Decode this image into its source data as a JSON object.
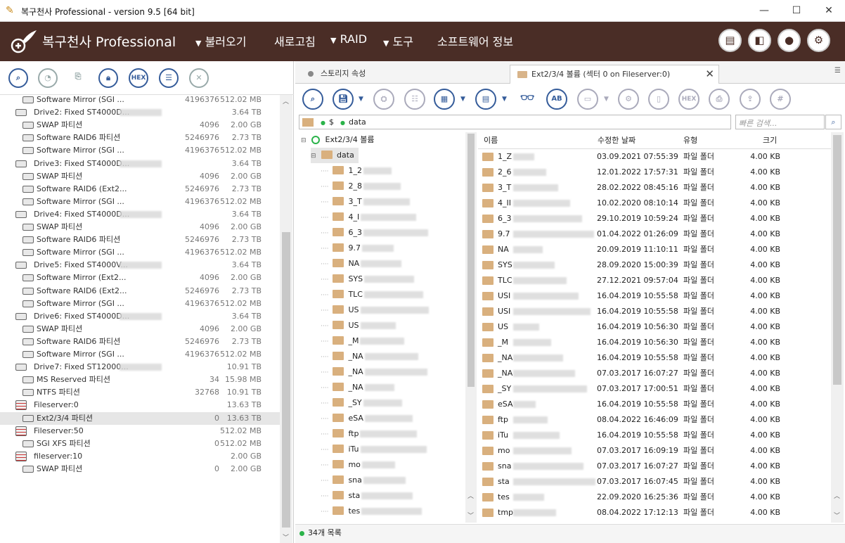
{
  "window": {
    "title": "복구천사 Professional - version 9.5 [64 bit]",
    "min": "—",
    "max": "☐",
    "close": "✕"
  },
  "header": {
    "brand": "복구천사 Professional",
    "menus": [
      {
        "label": "불러오기",
        "arrow": "▼"
      },
      {
        "label": "새로고침"
      },
      {
        "label": "RAID",
        "arrow": "▼"
      },
      {
        "label": "도구",
        "arrow": "▼"
      },
      {
        "label": "소프트웨어 정보"
      }
    ]
  },
  "left_toolbar": [
    "search-icon",
    "chart-icon",
    "drive-icon",
    "lock-icon",
    "HEX",
    "list-icon",
    "close-icon"
  ],
  "left_tree": [
    {
      "name": "Software Mirror (SGI ...",
      "a": "4196376",
      "b": "512.02 MB",
      "level": 2,
      "icon": "part"
    },
    {
      "name": "Drive2: Fixed ST4000D...",
      "a": "",
      "b": "3.64 TB",
      "level": 1,
      "icon": "drive"
    },
    {
      "name": "SWAP 파티션",
      "a": "4096",
      "b": "2.00 GB",
      "level": 2,
      "icon": "part"
    },
    {
      "name": "Software RAID6 파티션",
      "a": "5246976",
      "b": "2.73 TB",
      "level": 2,
      "icon": "part"
    },
    {
      "name": "Software Mirror (SGI ...",
      "a": "4196376",
      "b": "512.02 MB",
      "level": 2,
      "icon": "part"
    },
    {
      "name": "Drive3: Fixed ST4000D...",
      "a": "",
      "b": "3.64 TB",
      "level": 1,
      "icon": "drive"
    },
    {
      "name": "SWAP 파티션",
      "a": "4096",
      "b": "2.00 GB",
      "level": 2,
      "icon": "part"
    },
    {
      "name": "Software RAID6 (Ext2...",
      "a": "5246976",
      "b": "2.73 TB",
      "level": 2,
      "icon": "part"
    },
    {
      "name": "Software Mirror (SGI ...",
      "a": "4196376",
      "b": "512.02 MB",
      "level": 2,
      "icon": "part"
    },
    {
      "name": "Drive4: Fixed ST4000D...",
      "a": "",
      "b": "3.64 TB",
      "level": 1,
      "icon": "drive"
    },
    {
      "name": "SWAP 파티션",
      "a": "4096",
      "b": "2.00 GB",
      "level": 2,
      "icon": "part"
    },
    {
      "name": "Software RAID6 파티션",
      "a": "5246976",
      "b": "2.73 TB",
      "level": 2,
      "icon": "part"
    },
    {
      "name": "Software Mirror (SGI ...",
      "a": "4196376",
      "b": "512.02 MB",
      "level": 2,
      "icon": "part"
    },
    {
      "name": "Drive5: Fixed ST4000V...",
      "a": "",
      "b": "3.64 TB",
      "level": 1,
      "icon": "drive"
    },
    {
      "name": "Software Mirror (Ext2...",
      "a": "4096",
      "b": "2.00 GB",
      "level": 2,
      "icon": "part"
    },
    {
      "name": "Software RAID6 (Ext2...",
      "a": "5246976",
      "b": "2.73 TB",
      "level": 2,
      "icon": "part"
    },
    {
      "name": "Software Mirror (SGI ...",
      "a": "4196376",
      "b": "512.02 MB",
      "level": 2,
      "icon": "part"
    },
    {
      "name": "Drive6: Fixed ST4000D...",
      "a": "",
      "b": "3.64 TB",
      "level": 1,
      "icon": "drive"
    },
    {
      "name": "SWAP 파티션",
      "a": "4096",
      "b": "2.00 GB",
      "level": 2,
      "icon": "part"
    },
    {
      "name": "Software RAID6 파티션",
      "a": "5246976",
      "b": "2.73 TB",
      "level": 2,
      "icon": "part"
    },
    {
      "name": "Software Mirror (SGI ...",
      "a": "4196376",
      "b": "512.02 MB",
      "level": 2,
      "icon": "part"
    },
    {
      "name": "Drive7: Fixed ST12000...",
      "a": "",
      "b": "10.91 TB",
      "level": 1,
      "icon": "drive"
    },
    {
      "name": "MS Reserved 파티션",
      "a": "34",
      "b": "15.98 MB",
      "level": 2,
      "icon": "part"
    },
    {
      "name": "NTFS 파티션",
      "a": "32768",
      "b": "10.91 TB",
      "level": 2,
      "icon": "part"
    },
    {
      "name": "Fileserver:0",
      "a": "",
      "b": "13.63 TB",
      "level": 1,
      "icon": "server"
    },
    {
      "name": "Ext2/3/4 파티션",
      "a": "0",
      "b": "13.63 TB",
      "level": 2,
      "icon": "part",
      "sel": true
    },
    {
      "name": "Fileserver:50",
      "a": "",
      "b": "512.02 MB",
      "level": 1,
      "icon": "server"
    },
    {
      "name": "SGI XFS 파티션",
      "a": "0",
      "b": "512.02 MB",
      "level": 2,
      "icon": "part"
    },
    {
      "name": "fileserver:10",
      "a": "",
      "b": "2.00 GB",
      "level": 1,
      "icon": "server"
    },
    {
      "name": "SWAP 파티션",
      "a": "0",
      "b": "2.00 GB",
      "level": 2,
      "icon": "part"
    }
  ],
  "tabs": [
    {
      "label": "스토리지 속성"
    },
    {
      "label": "Ext2/3/4 볼륨 (섹터 0 on Fileserver:0)",
      "close": "✕"
    }
  ],
  "right_toolbar": [
    "search-icon",
    "save-icon",
    "recover-icon",
    "checklist-icon",
    "view-icon",
    "list-icon",
    "binoculars-icon",
    "AB",
    "image-icon",
    "file-settings-icon",
    "file-icon",
    "HEX",
    "print-icon",
    "export-icon",
    "hash-icon"
  ],
  "path": {
    "root": "$",
    "folder": "data"
  },
  "search": {
    "placeholder": "빠른 검색..."
  },
  "folder_tree": {
    "root": "Ext2/3/4 볼륨",
    "node": "data",
    "children": [
      "1_2",
      "2_8",
      "3_T",
      "4_I",
      "6_3",
      "9.7",
      "NA",
      "SYS",
      "TLC",
      "US",
      "US",
      "_M",
      "_NA",
      "_NA",
      "_NA",
      "_SY",
      "eSA",
      "ftp",
      "iTu",
      "mo",
      "sna",
      "sta",
      "tes"
    ]
  },
  "list": {
    "headers": {
      "name": "이름",
      "date": "수정한 날짜",
      "type": "유형",
      "size": "크기"
    },
    "rows": [
      {
        "n": "1_Z",
        "d": "03.09.2021 07:55:39",
        "t": "파일 폴더",
        "s": "4.00 KB"
      },
      {
        "n": "2_6",
        "d": "12.01.2022 17:57:31",
        "t": "파일 폴더",
        "s": "4.00 KB"
      },
      {
        "n": "3_T",
        "d": "28.02.2022 08:45:16",
        "t": "파일 폴더",
        "s": "4.00 KB"
      },
      {
        "n": "4_II",
        "d": "10.02.2020 08:10:14",
        "t": "파일 폴더",
        "s": "4.00 KB"
      },
      {
        "n": "6_3",
        "d": "29.10.2019 10:59:24",
        "t": "파일 폴더",
        "s": "4.00 KB"
      },
      {
        "n": "9.7",
        "d": "01.04.2022 01:26:09",
        "t": "파일 폴더",
        "s": "4.00 KB"
      },
      {
        "n": "NA",
        "d": "20.09.2019 11:10:11",
        "t": "파일 폴더",
        "s": "4.00 KB"
      },
      {
        "n": "SYS",
        "d": "28.09.2020 15:00:39",
        "t": "파일 폴더",
        "s": "4.00 KB"
      },
      {
        "n": "TLC",
        "d": "27.12.2021 09:57:04",
        "t": "파일 폴더",
        "s": "4.00 KB"
      },
      {
        "n": "USI",
        "d": "16.04.2019 10:55:58",
        "t": "파일 폴더",
        "s": "4.00 KB"
      },
      {
        "n": "USI",
        "d": "16.04.2019 10:55:58",
        "t": "파일 폴더",
        "s": "4.00 KB"
      },
      {
        "n": "US",
        "d": "16.04.2019 10:56:30",
        "t": "파일 폴더",
        "s": "4.00 KB"
      },
      {
        "n": "_M",
        "d": "16.04.2019 10:56:30",
        "t": "파일 폴더",
        "s": "4.00 KB"
      },
      {
        "n": "_NA",
        "d": "16.04.2019 10:55:58",
        "t": "파일 폴더",
        "s": "4.00 KB"
      },
      {
        "n": "_NA",
        "d": "07.03.2017 16:07:27",
        "t": "파일 폴더",
        "s": "4.00 KB"
      },
      {
        "n": "_SY",
        "d": "07.03.2017 17:00:51",
        "t": "파일 폴더",
        "s": "4.00 KB"
      },
      {
        "n": "eSA",
        "d": "16.04.2019 10:55:58",
        "t": "파일 폴더",
        "s": "4.00 KB"
      },
      {
        "n": "ftp",
        "d": "08.04.2022 16:46:09",
        "t": "파일 폴더",
        "s": "4.00 KB"
      },
      {
        "n": "iTu",
        "d": "16.04.2019 10:55:58",
        "t": "파일 폴더",
        "s": "4.00 KB"
      },
      {
        "n": "mo",
        "d": "07.03.2017 16:09:19",
        "t": "파일 폴더",
        "s": "4.00 KB"
      },
      {
        "n": "sna",
        "d": "07.03.2017 16:07:27",
        "t": "파일 폴더",
        "s": "4.00 KB"
      },
      {
        "n": "sta",
        "d": "07.03.2017 16:07:45",
        "t": "파일 폴더",
        "s": "4.00 KB"
      },
      {
        "n": "tes",
        "d": "22.09.2020 16:25:36",
        "t": "파일 폴더",
        "s": "4.00 KB"
      },
      {
        "n": "tmp",
        "d": "08.04.2022 17:12:13",
        "t": "파일 폴더",
        "s": "4.00 KB"
      }
    ]
  },
  "status": {
    "text": "34개 목록"
  }
}
